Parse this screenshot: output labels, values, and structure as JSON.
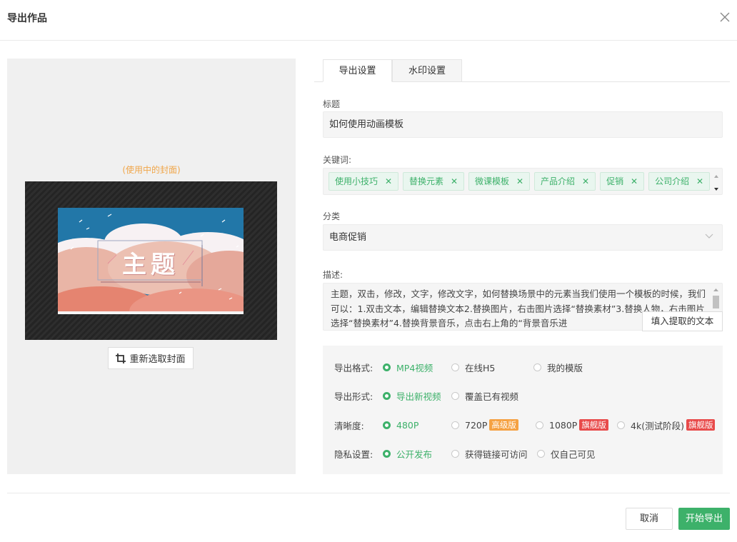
{
  "dialog": {
    "title": "导出作品",
    "close_icon": "close-icon"
  },
  "preview": {
    "caption": "(使用中的封面)",
    "cover_text": "主题",
    "recrop_label": "重新选取封面",
    "recrop_icon": "crop-icon"
  },
  "tabs": [
    {
      "label": "导出设置",
      "active": true
    },
    {
      "label": "水印设置",
      "active": false
    }
  ],
  "form": {
    "title_label": "标题",
    "title_value": "如何使用动画模板",
    "keywords_label": "关键词:",
    "keywords": [
      "使用小技巧",
      "替换元素",
      "微课模板",
      "产品介绍",
      "促销",
      "公司介绍"
    ],
    "category_label": "分类",
    "category_value": "电商促销",
    "desc_label": "描述:",
    "desc_value": "主题，双击，修改，文字，修改文字，如何替换场景中的元素当我们使用一个模板的时候，我们可以：1.双击文本，编辑替换文本2.替换图片，右击图片选择“替换素材”3.替换人物，右击图片选择“替换素材”4.替换背景音乐，点击右上角的“背景音乐进",
    "fill_button": "填入提取的文本"
  },
  "options": {
    "format": {
      "label": "导出格式:",
      "choices": [
        "MP4视频",
        "在线H5",
        "我的模版"
      ],
      "selected": "MP4视频"
    },
    "mode": {
      "label": "导出形式:",
      "choices": [
        "导出新视频",
        "覆盖已有视频"
      ],
      "selected": "导出新视频"
    },
    "resolution": {
      "label": "清晰度:",
      "choices": [
        {
          "label": "480P",
          "badge": ""
        },
        {
          "label": "720P",
          "badge": "高级版"
        },
        {
          "label": "1080P",
          "badge": "旗舰版"
        },
        {
          "label": "4k(测试阶段)",
          "badge": "旗舰版"
        }
      ],
      "selected": "480P"
    },
    "privacy": {
      "label": "隐私设置:",
      "choices": [
        "公开发布",
        "获得链接可访问",
        "仅自己可见"
      ],
      "selected": "公开发布"
    }
  },
  "footer": {
    "cancel": "取消",
    "start": "开始导出"
  },
  "colors": {
    "accent": "#3db16a",
    "badge_pro": "#f5a142",
    "badge_flag": "#e84a4a",
    "caption": "#f0a64a"
  }
}
